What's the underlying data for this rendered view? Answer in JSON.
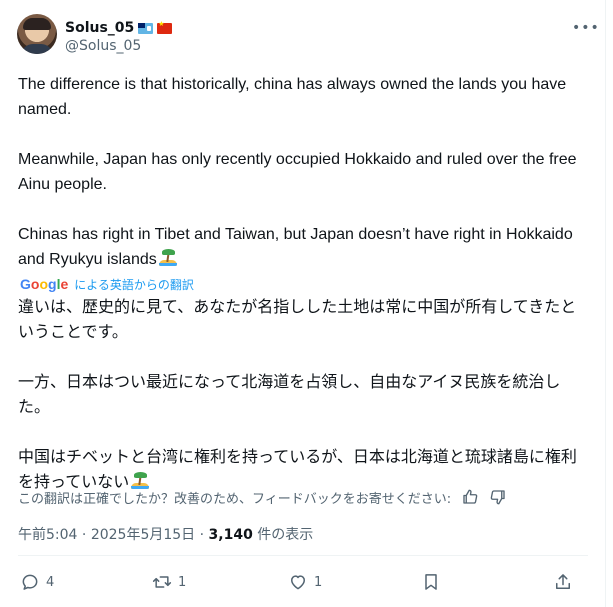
{
  "author": {
    "display_name": "Solus_05",
    "handle": "@Solus_05",
    "flags": [
      "fiji-flag",
      "china-flag"
    ]
  },
  "more_icon": "more-dots-icon",
  "tweet": {
    "paragraphs": [
      "The difference is that historically, china has always owned the lands you have named.",
      "Meanwhile, Japan has only recently occupied Hokkaido and ruled over the free Ainu people.",
      "Chinas has right in Tibet and Taiwan, but Japan doesn’t have right in Hokkaido and Ryukyu islands"
    ]
  },
  "translation": {
    "provider": [
      "G",
      "o",
      "o",
      "g",
      "l",
      "e"
    ],
    "label": "による英語からの翻訳",
    "paragraphs": [
      "違いは、歴史的に見て、あなたが名指しした土地は常に中国が所有してきたということです。",
      "一方、日本はつい最近になって北海道を占領し、自由なアイヌ民族を統治した。",
      "中国はチベットと台湾に権利を持っているが、日本は北海道と琉球諸島に権利を持っていない"
    ],
    "feedback": "この翻訳は正確でしたか？改善のため、フィードバックをお寄せください:"
  },
  "meta": {
    "time": "午前5:04",
    "separator": "·",
    "date": "2025年5月15日",
    "views_count": "3,140",
    "views_label": "件の表示"
  },
  "actions": {
    "reply_count": "4",
    "repost_count": "1",
    "like_count": "1"
  },
  "colors": {
    "text": "#0f1419",
    "secondary": "#536471",
    "link": "#1d9bf0",
    "divider": "#eff3f4"
  }
}
